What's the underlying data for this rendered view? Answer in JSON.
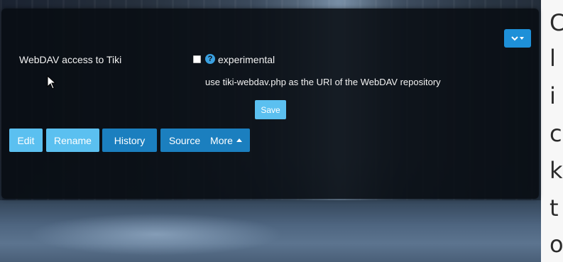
{
  "preference": {
    "label": "WebDAV access to Tiki",
    "badge": "experimental",
    "hint": "use tiki-webdav.php as the URI of the WebDAV repository",
    "checked": false
  },
  "form": {
    "save_label": "Save"
  },
  "actions": {
    "edit": "Edit",
    "rename": "Rename",
    "history": "History",
    "source": "Source",
    "more": "More"
  },
  "edge_text": [
    "C",
    "l",
    "i",
    "c",
    "k",
    "t",
    "o"
  ],
  "icons": {
    "dropdown": "chevron-down-icon",
    "help": "question-circle-icon",
    "more_caret": "caret-up-icon",
    "cursor": "mouse-pointer-icon"
  },
  "colors": {
    "panel": "#080c12",
    "button_light": "#5bc0f0",
    "button_dark": "#1b7fbf",
    "accent": "#1e90d8"
  }
}
